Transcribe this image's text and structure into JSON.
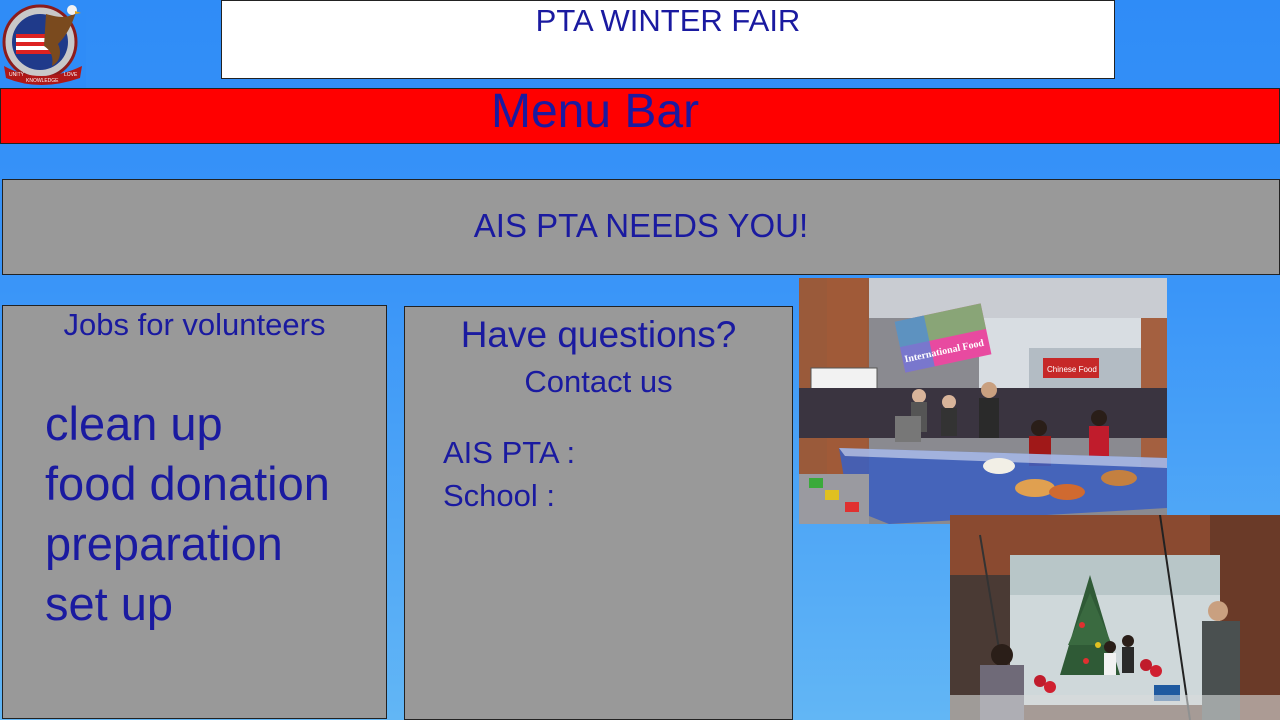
{
  "header": {
    "title": "PTA WINTER FAIR",
    "logo": {
      "icon": "eagle-flag-emblem-icon",
      "ribbon_left": "UNITY",
      "ribbon_center": "KNOWLEDGE",
      "ribbon_right": "LOVE"
    }
  },
  "menu_bar": {
    "label": "Menu Bar"
  },
  "banner": {
    "text": "AIS PTA NEEDS YOU!"
  },
  "jobs": {
    "title": "Jobs for volunteers",
    "items": [
      "clean up",
      "food donation",
      "preparation",
      "set up"
    ]
  },
  "contact": {
    "question": "Have questions?",
    "title": "Contact us",
    "ais_label": "AIS PTA :",
    "school_label": "School :"
  },
  "photos": {
    "food": {
      "sign": "International Food",
      "stall_sign": "Chinese Food"
    },
    "xmas": {}
  },
  "colors": {
    "background": "#2f8cf7",
    "menu_bar": "#ff0000",
    "panel": "#999999",
    "text": "#1a1aa0"
  }
}
